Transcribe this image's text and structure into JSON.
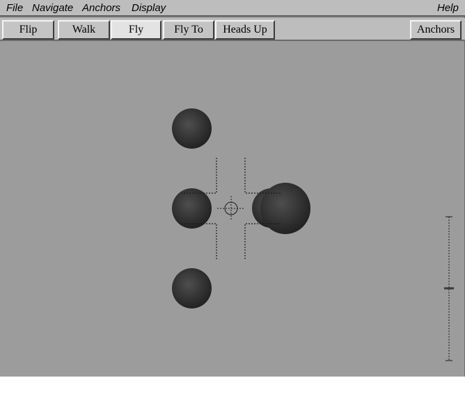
{
  "menubar": {
    "file": "File",
    "navigate": "Navigate",
    "anchors": "Anchors",
    "display": "Display",
    "help": "Help"
  },
  "toolbar": {
    "flip": "Flip",
    "walk": "Walk",
    "fly": "Fly",
    "fly_to": "Fly To",
    "heads_up": "Heads Up",
    "anchors": "Anchors",
    "active_mode": "Fly"
  },
  "colors": {
    "background": "#9c9c9c",
    "chrome": "#bdbdbd",
    "sphere": "#2a2a2a"
  },
  "scene": {
    "sphere_count": 5,
    "icons": [
      "crosshair-icon",
      "viewfinder-bracket-icon",
      "height-gauge-icon"
    ]
  }
}
